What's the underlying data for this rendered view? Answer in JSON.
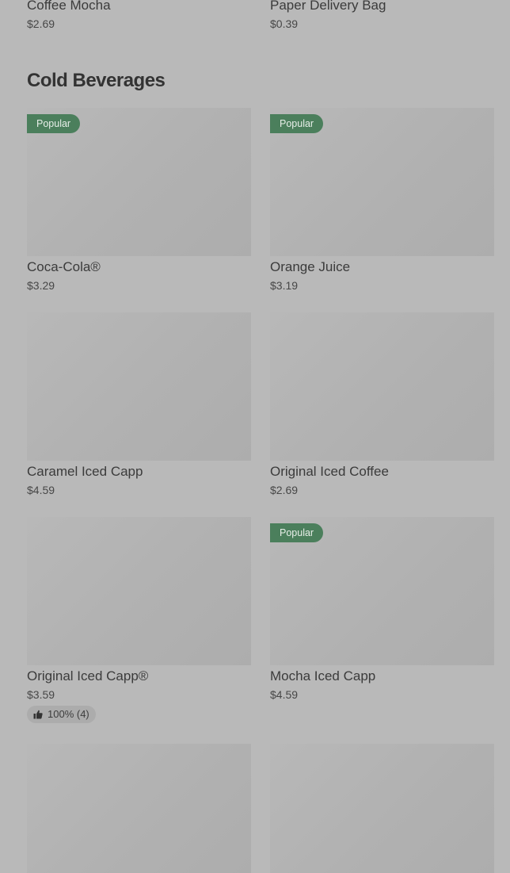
{
  "top_items": [
    {
      "name": "Coffee Mocha",
      "price": "$2.69"
    },
    {
      "name": "Paper Delivery Bag",
      "price": "$0.39"
    }
  ],
  "section": {
    "title": "Cold Beverages"
  },
  "items": [
    {
      "name": "Coca-Cola®",
      "price": "$3.29",
      "badge": "Popular"
    },
    {
      "name": "Orange Juice",
      "price": "$3.19",
      "badge": "Popular"
    },
    {
      "name": "Caramel Iced Capp",
      "price": "$4.59"
    },
    {
      "name": "Original Iced Coffee",
      "price": "$2.69"
    },
    {
      "name": "Original Iced Capp®",
      "price": "$3.59",
      "rating": "100% (4)"
    },
    {
      "name": "Mocha Iced Capp",
      "price": "$4.59",
      "badge": "Popular"
    }
  ],
  "colors": {
    "badge_bg": "#4b7f5c",
    "page_bg": "#b9b9b9"
  },
  "icons": {
    "rating": "thumbs-up-icon"
  }
}
